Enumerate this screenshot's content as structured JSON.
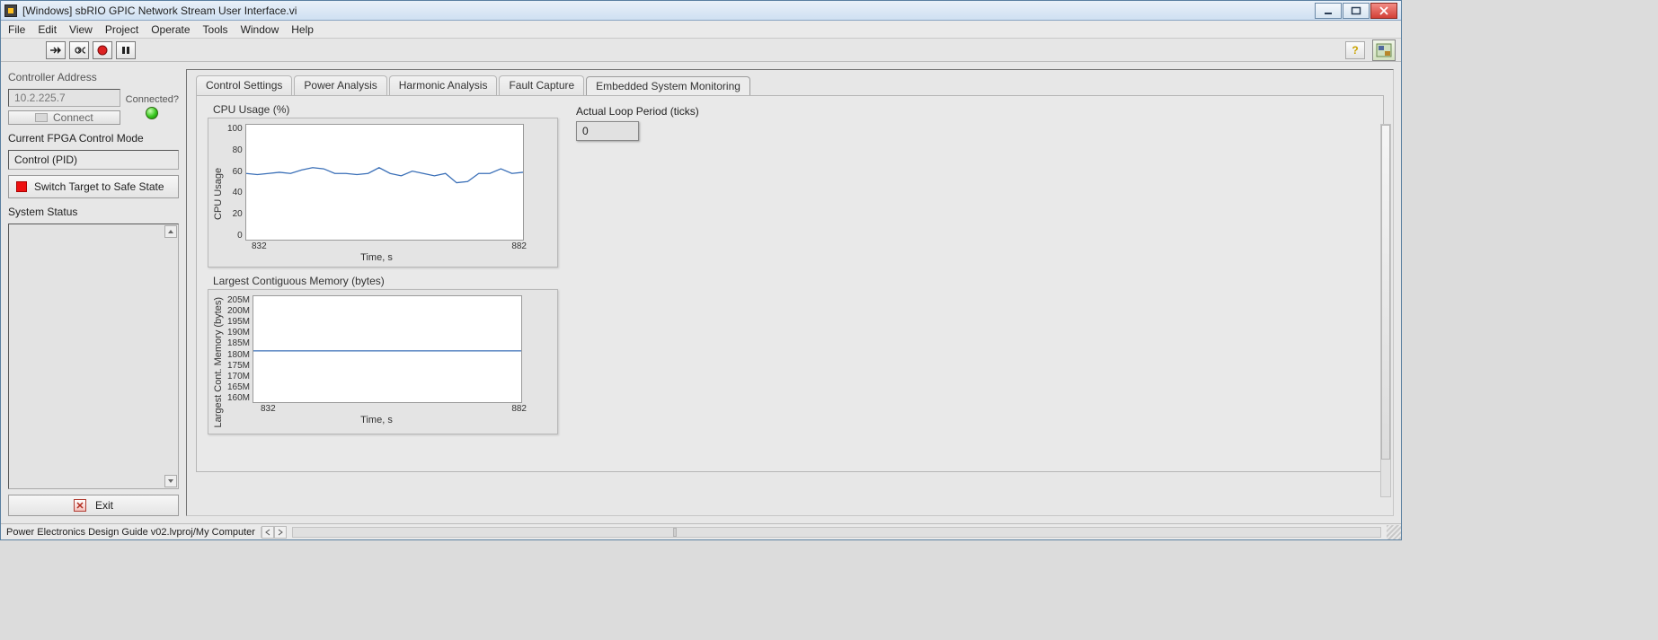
{
  "window": {
    "title": "[Windows] sbRIO GPIC Network Stream User Interface.vi"
  },
  "menu": {
    "items": [
      "File",
      "Edit",
      "View",
      "Project",
      "Operate",
      "Tools",
      "Window",
      "Help"
    ]
  },
  "left": {
    "controller_address_label": "Controller Address",
    "controller_address_value": "10.2.225.7",
    "connect_label": "Connect",
    "connected_label": "Connected?",
    "fpga_mode_label": "Current FPGA Control Mode",
    "fpga_mode_value": "Control (PID)",
    "safe_state_label": "Switch Target to Safe State",
    "system_status_label": "System Status",
    "exit_label": "Exit"
  },
  "tabs": {
    "items": [
      "Control Settings",
      "Power Analysis",
      "Harmonic Analysis",
      "Fault Capture",
      "Embedded System Monitoring"
    ],
    "active_index": 4
  },
  "monitor": {
    "cpu_title": "CPU Usage (%)",
    "mem_title": "Largest Contiguous Memory (bytes)",
    "loop_label": "Actual Loop Period (ticks)",
    "loop_value": "0"
  },
  "statusbar": {
    "left": "Power Electronics Design Guide v02.lvproj/My Computer"
  },
  "chart_data": [
    {
      "type": "line",
      "title": "CPU Usage (%)",
      "xlabel": "Time, s",
      "ylabel": "CPU Usage",
      "xlim": [
        832,
        882
      ],
      "ylim": [
        0,
        100
      ],
      "x_ticks": [
        832,
        882
      ],
      "y_ticks": [
        0,
        20,
        40,
        60,
        80,
        100
      ],
      "x": [
        832,
        834,
        836,
        838,
        840,
        842,
        844,
        846,
        848,
        850,
        852,
        854,
        856,
        858,
        860,
        862,
        864,
        866,
        868,
        870,
        872,
        874,
        876,
        878,
        880,
        882
      ],
      "values": [
        58,
        57,
        58,
        59,
        58,
        61,
        63,
        62,
        58,
        58,
        57,
        58,
        63,
        58,
        56,
        60,
        58,
        56,
        58,
        50,
        51,
        58,
        58,
        62,
        58,
        59
      ]
    },
    {
      "type": "line",
      "title": "Largest Contiguous Memory (bytes)",
      "xlabel": "Time, s",
      "ylabel": "Largest Cont. Memory (bytes)",
      "xlim": [
        832,
        882
      ],
      "ylim": [
        160,
        205
      ],
      "x_ticks": [
        832,
        882
      ],
      "y_ticks_labels": [
        "160M",
        "165M",
        "170M",
        "175M",
        "180M",
        "185M",
        "190M",
        "195M",
        "200M",
        "205M"
      ],
      "y_ticks": [
        160,
        165,
        170,
        175,
        180,
        185,
        190,
        195,
        200,
        205
      ],
      "x": [
        832,
        882
      ],
      "values": [
        182,
        182
      ]
    }
  ]
}
